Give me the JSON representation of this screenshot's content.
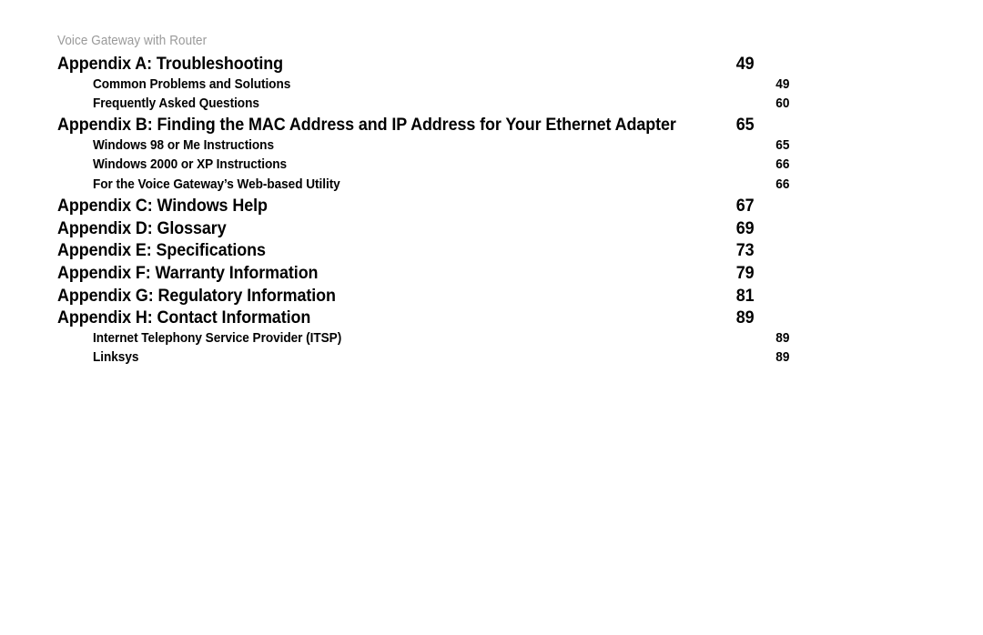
{
  "document": {
    "running_header": "Voice Gateway with Router"
  },
  "toc": {
    "entries": [
      {
        "level": 1,
        "label": "Appendix A: Troubleshooting",
        "page": "49"
      },
      {
        "level": 2,
        "label": "Common Problems and Solutions",
        "page": "49"
      },
      {
        "level": 2,
        "label": "Frequently Asked Questions",
        "page": "60"
      },
      {
        "level": 1,
        "label": "Appendix B: Finding the MAC Address and IP Address for Your Ethernet Adapter",
        "page": "65"
      },
      {
        "level": 2,
        "label": "Windows 98 or Me Instructions",
        "page": "65"
      },
      {
        "level": 2,
        "label": "Windows 2000 or XP Instructions",
        "page": "66"
      },
      {
        "level": 2,
        "label": "For the Voice Gateway’s Web-based Utility",
        "page": "66"
      },
      {
        "level": 1,
        "label": "Appendix C: Windows Help",
        "page": "67"
      },
      {
        "level": 1,
        "label": "Appendix D: Glossary",
        "page": "69"
      },
      {
        "level": 1,
        "label": "Appendix E: Specifications",
        "page": "73"
      },
      {
        "level": 1,
        "label": "Appendix F: Warranty Information",
        "page": "79"
      },
      {
        "level": 1,
        "label": "Appendix G: Regulatory Information",
        "page": "81"
      },
      {
        "level": 1,
        "label": "Appendix H: Contact Information",
        "page": "89"
      },
      {
        "level": 2,
        "label": "Internet Telephony Service Provider (ITSP)",
        "page": "89"
      },
      {
        "level": 2,
        "label": "Linksys",
        "page": "89"
      }
    ]
  },
  "colors": {
    "text": "#000000",
    "running_header": "#9a9a9a",
    "background": "#ffffff"
  }
}
